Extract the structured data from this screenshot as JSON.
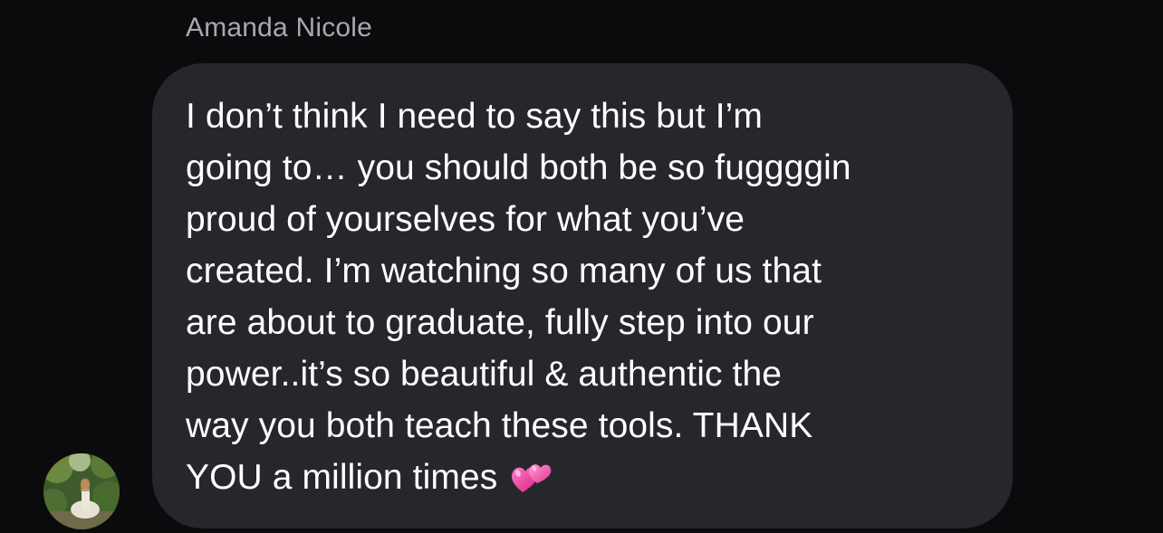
{
  "sender": {
    "name": "Amanda Nicole"
  },
  "message": {
    "lines": [
      "I don’t think I need to say this but I’m",
      "going to… you should both be so fuggggin",
      "proud of yourselves for what you’ve",
      "created. I’m watching so many of us that",
      "are about to graduate, fully step into our",
      "power..it’s so beautiful & authentic the",
      "way you both teach these tools. THANK",
      "YOU a million times"
    ],
    "emoji": "two-hearts-icon"
  },
  "colors": {
    "background": "#0b0b0d",
    "bubble": "#26272c",
    "name_text": "#a8a9ae",
    "message_text": "#ffffff",
    "heart_pink": "#f04fa8"
  }
}
